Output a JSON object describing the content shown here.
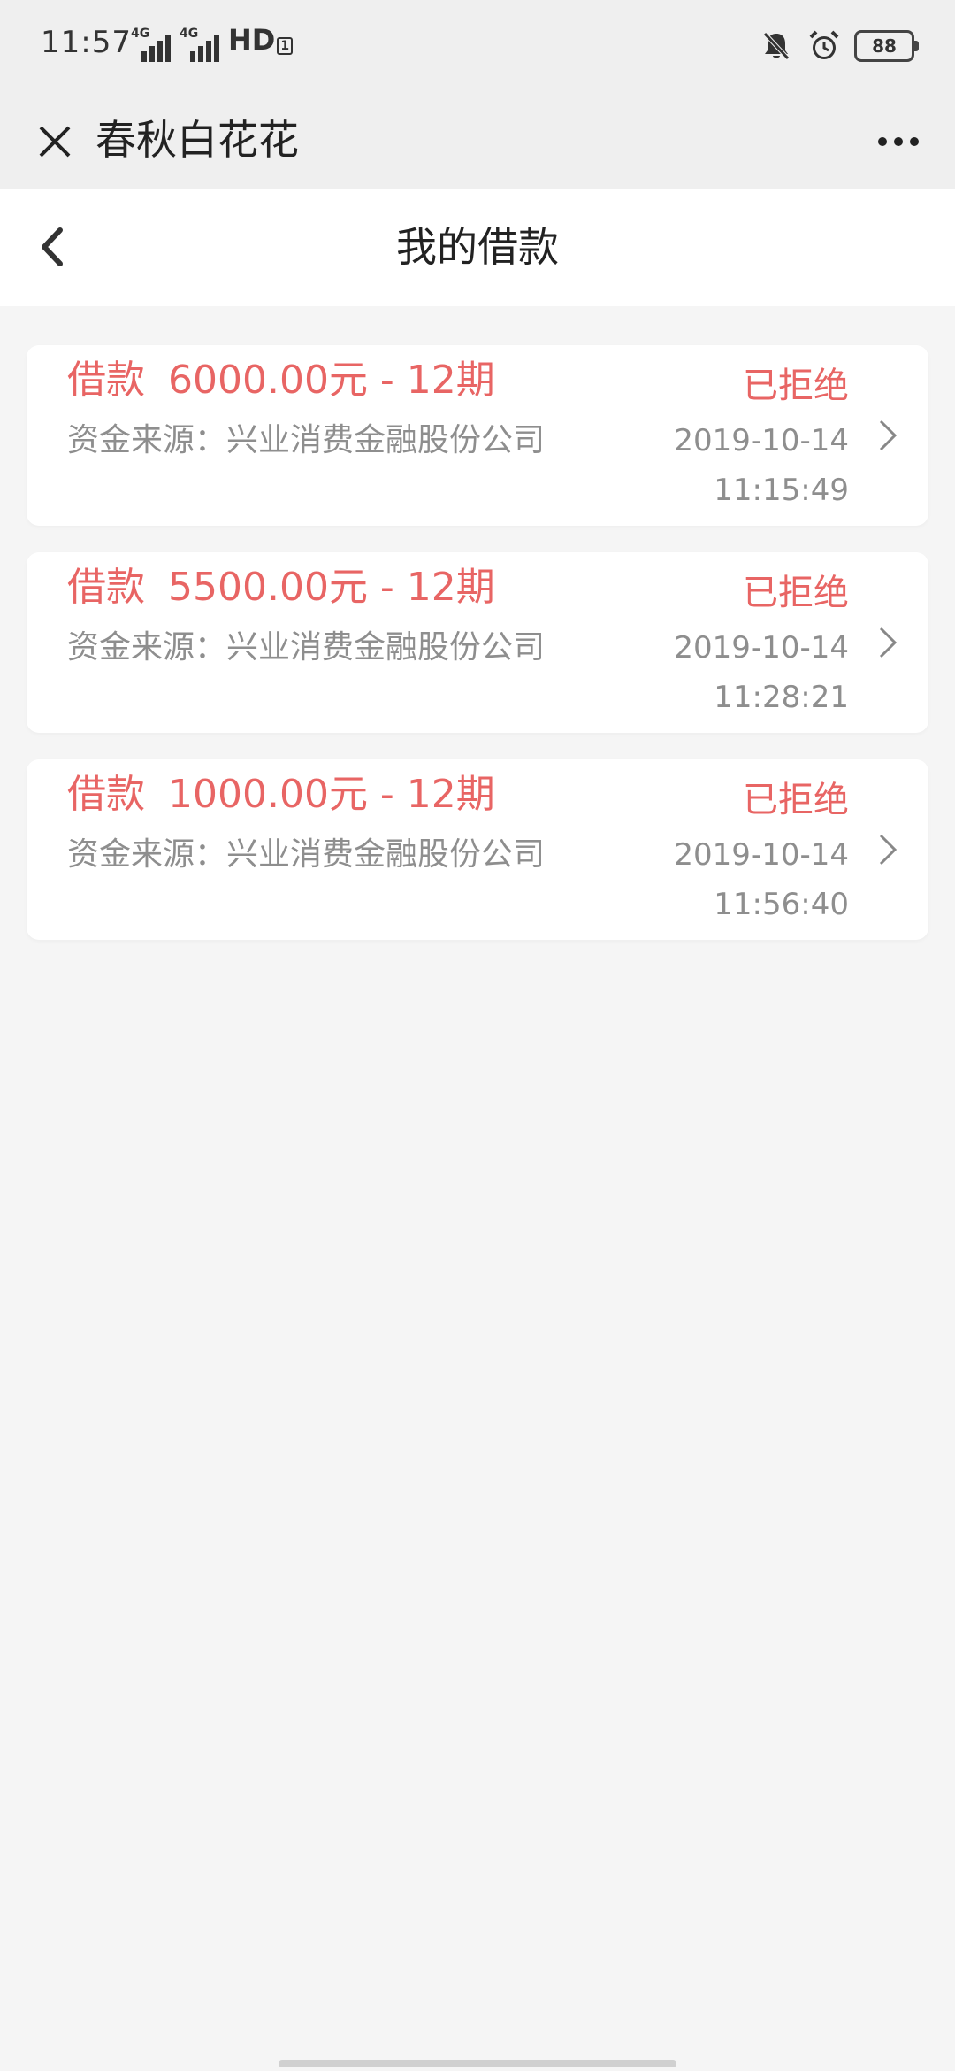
{
  "status_bar": {
    "time": "11:57",
    "network_1": "4G",
    "network_2": "4G",
    "hd_label": "HD",
    "hd_sub": "1",
    "battery": "88"
  },
  "app_header": {
    "title": "春秋白花花"
  },
  "page_header": {
    "title": "我的借款"
  },
  "loans": [
    {
      "label": "借款",
      "amount": "6000.00元 - 12期",
      "source": "资金来源：兴业消费金融股份公司",
      "status": "已拒绝",
      "date": "2019-10-14",
      "time": "11:15:49"
    },
    {
      "label": "借款",
      "amount": "5500.00元 - 12期",
      "source": "资金来源：兴业消费金融股份公司",
      "status": "已拒绝",
      "date": "2019-10-14",
      "time": "11:28:21"
    },
    {
      "label": "借款",
      "amount": "1000.00元 - 12期",
      "source": "资金来源：兴业消费金融股份公司",
      "status": "已拒绝",
      "date": "2019-10-14",
      "time": "11:56:40"
    }
  ],
  "colors": {
    "accent": "#e86564",
    "secondary_text": "#8e8e8e",
    "background": "#f5f5f5"
  }
}
